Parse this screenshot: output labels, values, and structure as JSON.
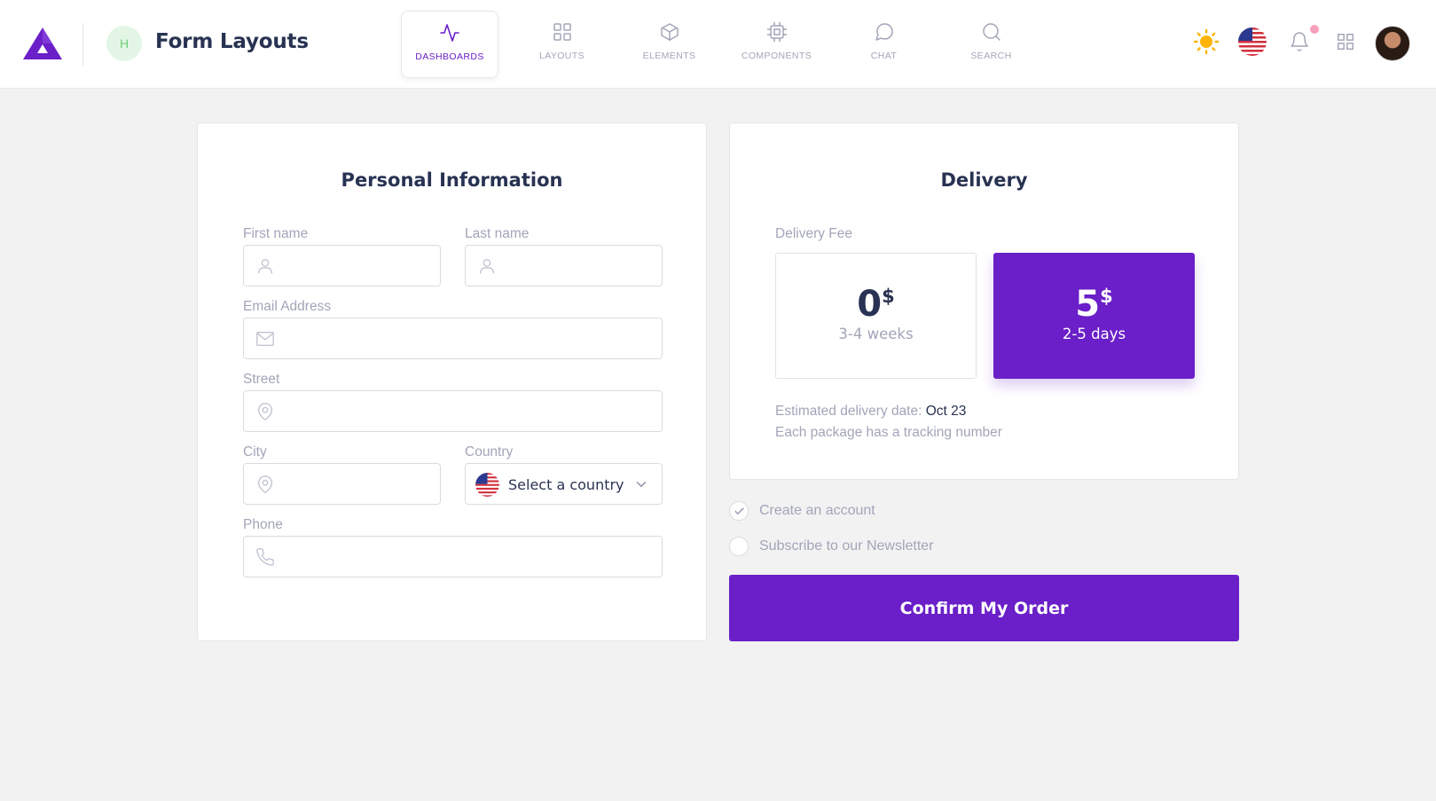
{
  "header": {
    "initial": "H",
    "title": "Form Layouts",
    "nav": [
      {
        "label": "DASHBOARDS",
        "icon": "activity-icon",
        "active": true
      },
      {
        "label": "LAYOUTS",
        "icon": "grid-icon",
        "active": false
      },
      {
        "label": "ELEMENTS",
        "icon": "box-icon",
        "active": false
      },
      {
        "label": "COMPONENTS",
        "icon": "cpu-icon",
        "active": false
      },
      {
        "label": "CHAT",
        "icon": "message-circle-icon",
        "active": false
      },
      {
        "label": "SEARCH",
        "icon": "search-icon",
        "active": false
      }
    ],
    "right_icons": [
      "sun-icon",
      "us-flag-icon",
      "bell-icon",
      "apps-grid-icon",
      "user-avatar"
    ]
  },
  "personal": {
    "title": "Personal Information",
    "first_name": {
      "label": "First name",
      "value": "",
      "icon": "user-icon"
    },
    "last_name": {
      "label": "Last name",
      "value": "",
      "icon": "user-icon"
    },
    "email": {
      "label": "Email Address",
      "value": "",
      "icon": "mail-icon"
    },
    "street": {
      "label": "Street",
      "value": "",
      "icon": "map-pin-icon"
    },
    "city": {
      "label": "City",
      "value": "",
      "icon": "map-pin-icon"
    },
    "country": {
      "label": "Country",
      "selected": "Select a country",
      "icon": "us-flag-icon"
    },
    "phone": {
      "label": "Phone",
      "value": "",
      "icon": "phone-icon"
    }
  },
  "delivery": {
    "title": "Delivery",
    "fee_label": "Delivery Fee",
    "options": [
      {
        "amount": "0",
        "currency": "$",
        "time": "3-4 weeks",
        "selected": false
      },
      {
        "amount": "5",
        "currency": "$",
        "time": "2-5 days",
        "selected": true
      }
    ],
    "estimated_label": "Estimated delivery date:",
    "estimated_date": "Oct 23",
    "tracking_note": "Each package has a tracking number"
  },
  "options": {
    "create_account": {
      "label": "Create an account",
      "checked": true
    },
    "newsletter": {
      "label": "Subscribe to our Newsletter",
      "checked": false
    }
  },
  "confirm_label": "Confirm My Order",
  "colors": {
    "primary": "#6a1fc8",
    "text_dark": "#283252",
    "text_muted": "#a2a5b9",
    "background": "#f2f2f2",
    "sun": "#ffb400",
    "badge_green": "#6fd07b"
  }
}
